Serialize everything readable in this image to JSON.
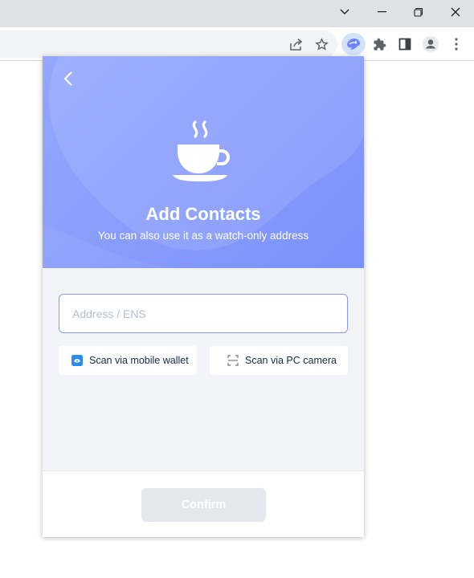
{
  "popup": {
    "title": "Add Contacts",
    "subtitle": "You can also use it as a watch-only address",
    "address_input": {
      "value": "",
      "placeholder": "Address / ENS"
    },
    "scan_mobile_label": "Scan via mobile wallet",
    "scan_pc_label": "Scan via PC camera",
    "confirm_label": "Confirm"
  },
  "icons": {
    "back": "chevron-left-icon",
    "hero": "coffee-cup-icon",
    "scan_mobile": "mobile-wallet-icon",
    "scan_pc": "scan-frame-icon"
  },
  "colors": {
    "accent": "#8697ff",
    "hero_start": "#94a7fd",
    "hero_end": "#7b91fc",
    "confirm_disabled": "#e4e7ee"
  }
}
